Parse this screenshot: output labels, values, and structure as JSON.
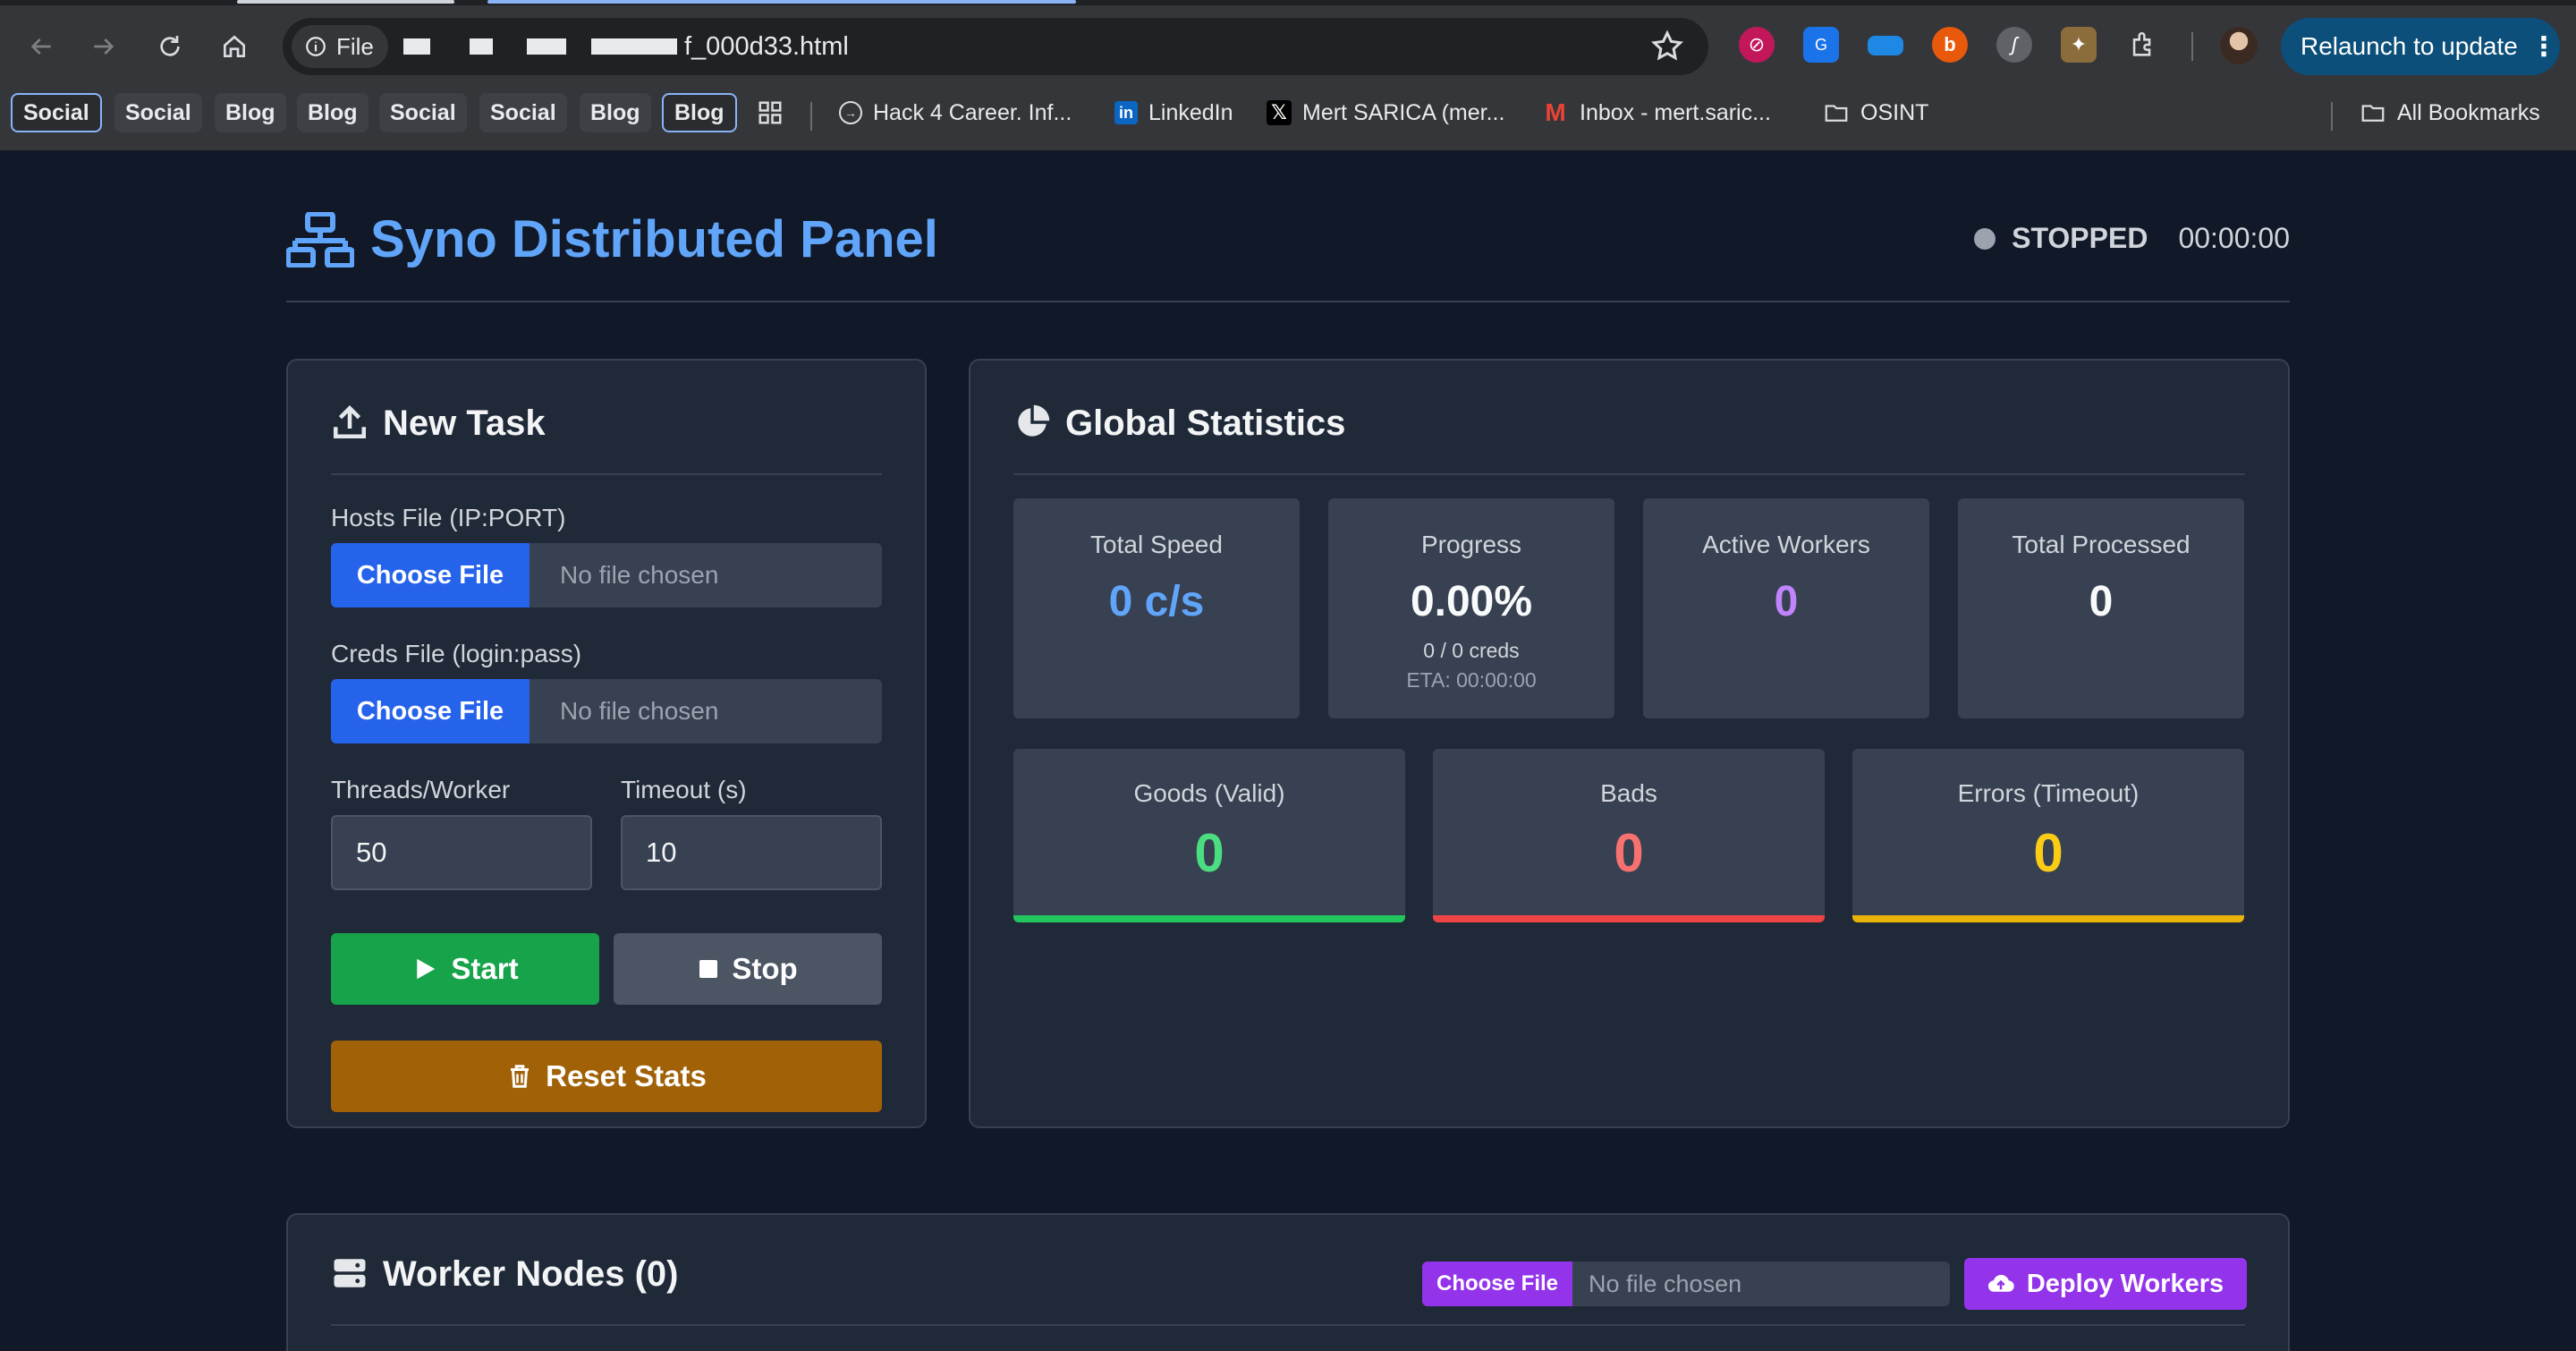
{
  "browser": {
    "url_chip": "File",
    "url_tail": "f_000d33.html",
    "relaunch_label": "Relaunch to update",
    "bookmarks": [
      {
        "label": "Social",
        "style": "outline"
      },
      {
        "label": "Social",
        "style": "pill"
      },
      {
        "label": "Blog",
        "style": "pill"
      },
      {
        "label": "Blog",
        "style": "pill"
      },
      {
        "label": "Social",
        "style": "pill"
      },
      {
        "label": "Social",
        "style": "pill"
      },
      {
        "label": "Blog",
        "style": "pill"
      },
      {
        "label": "Blog",
        "style": "outline"
      },
      {
        "label": "Hack 4 Career. Inf...",
        "icon": "hack4career-icon"
      },
      {
        "label": "LinkedIn",
        "icon": "linkedin-icon"
      },
      {
        "label": "Mert SARICA (mer...",
        "icon": "x-icon"
      },
      {
        "label": "Inbox - mert.saric...",
        "icon": "gmail-icon"
      },
      {
        "label": "OSINT",
        "icon": "folder-icon"
      },
      {
        "label": "All Bookmarks",
        "icon": "folder-icon"
      }
    ]
  },
  "header": {
    "title": "Syno Distributed Panel",
    "status": "STOPPED",
    "timer": "00:00:00"
  },
  "new_task": {
    "title": "New Task",
    "hosts_label": "Hosts File (IP:PORT)",
    "creds_label": "Creds File (login:pass)",
    "choose_file": "Choose File",
    "no_file": "No file chosen",
    "threads_label": "Threads/Worker",
    "threads_value": "50",
    "timeout_label": "Timeout (s)",
    "timeout_value": "10",
    "start": "Start",
    "stop": "Stop",
    "reset": "Reset Stats"
  },
  "stats": {
    "title": "Global Statistics",
    "total_speed_label": "Total Speed",
    "total_speed": "0 c/s",
    "progress_label": "Progress",
    "progress": "0.00%",
    "progress_creds": "0 / 0 creds",
    "progress_eta": "ETA: 00:00:00",
    "active_workers_label": "Active Workers",
    "active_workers": "0",
    "total_processed_label": "Total Processed",
    "total_processed": "0",
    "goods_label": "Goods (Valid)",
    "goods": "0",
    "bads_label": "Bads",
    "bads": "0",
    "errors_label": "Errors (Timeout)",
    "errors": "0"
  },
  "workers": {
    "title": "Worker Nodes (0)",
    "choose_file": "Choose File",
    "no_file": "No file chosen",
    "deploy": "Deploy Workers"
  },
  "colors": {
    "accent": "#60a5fa",
    "green": "#16a34a",
    "red": "#ef4444",
    "yellow": "#eab308",
    "purple": "#9333ea",
    "amber": "#a16207"
  }
}
